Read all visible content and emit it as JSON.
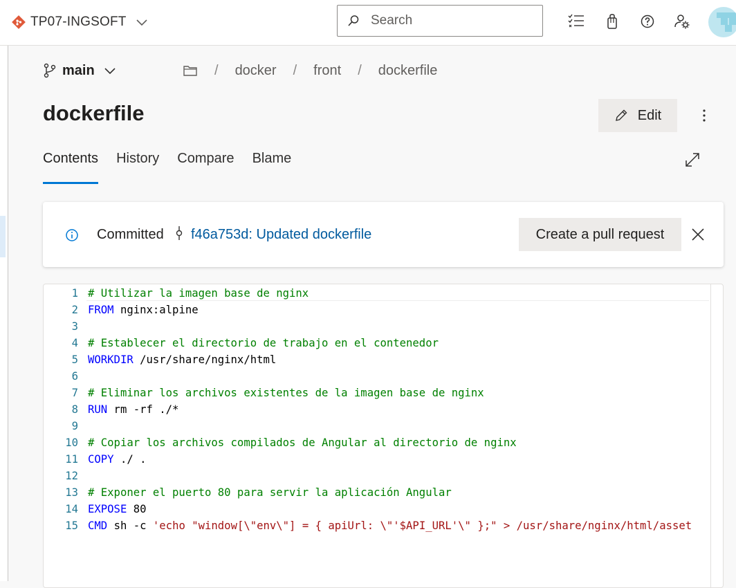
{
  "header": {
    "project_name": "TP07-INGSOFT",
    "search_placeholder": "Search"
  },
  "branch": {
    "name": "main"
  },
  "breadcrumb": [
    "docker",
    "front",
    "dockerfile"
  ],
  "file": {
    "title": "dockerfile",
    "edit_label": "Edit"
  },
  "tabs": [
    "Contents",
    "History",
    "Compare",
    "Blame"
  ],
  "banner": {
    "committed_label": "Committed",
    "commit_link": "f46a753d: Updated dockerfile",
    "pr_button": "Create a pull request"
  },
  "code": {
    "lines": [
      {
        "n": "1",
        "kw": "",
        "rest": "# Utilizar la imagen base de nginx",
        "cls": "cm"
      },
      {
        "n": "2",
        "kw": "FROM",
        "rest": " nginx:alpine",
        "cls": "pl"
      },
      {
        "n": "3",
        "kw": "",
        "rest": "",
        "cls": "pl"
      },
      {
        "n": "4",
        "kw": "",
        "rest": "# Establecer el directorio de trabajo en el contenedor",
        "cls": "cm"
      },
      {
        "n": "5",
        "kw": "WORKDIR",
        "rest": " /usr/share/nginx/html",
        "cls": "pl"
      },
      {
        "n": "6",
        "kw": "",
        "rest": "",
        "cls": "pl"
      },
      {
        "n": "7",
        "kw": "",
        "rest": "# Eliminar los archivos existentes de la imagen base de nginx",
        "cls": "cm"
      },
      {
        "n": "8",
        "kw": "RUN",
        "rest": " rm -rf ./*",
        "cls": "pl"
      },
      {
        "n": "9",
        "kw": "",
        "rest": "",
        "cls": "pl"
      },
      {
        "n": "10",
        "kw": "",
        "rest": "# Copiar los archivos compilados de Angular al directorio de nginx",
        "cls": "cm"
      },
      {
        "n": "11",
        "kw": "COPY",
        "rest": " ./ .",
        "cls": "pl"
      },
      {
        "n": "12",
        "kw": "",
        "rest": "",
        "cls": "pl"
      },
      {
        "n": "13",
        "kw": "",
        "rest": "# Exponer el puerto 80 para servir la aplicación Angular",
        "cls": "cm"
      },
      {
        "n": "14",
        "kw": "EXPOSE",
        "rest": " 80",
        "cls": "pl"
      },
      {
        "n": "15",
        "kw": "CMD",
        "rest": "sh -c",
        "cls": "pl",
        "str": "'echo \"window[\\\"env\\\"] = { apiUrl: \\\"'$API_URL'\\\" };\" > /usr/share/nginx/html/asset"
      }
    ]
  },
  "colors": {
    "accent": "#0078d4",
    "link": "#005a9e",
    "comment": "#008000",
    "keyword": "#0000ff",
    "string": "#a31515",
    "logo": "#e05a3a"
  },
  "icons": {
    "project_logo": "azure-repos-logo",
    "task_list": "task-list-icon",
    "marketplace": "shopping-bag-icon",
    "help": "help-icon",
    "settings": "user-settings-icon"
  }
}
